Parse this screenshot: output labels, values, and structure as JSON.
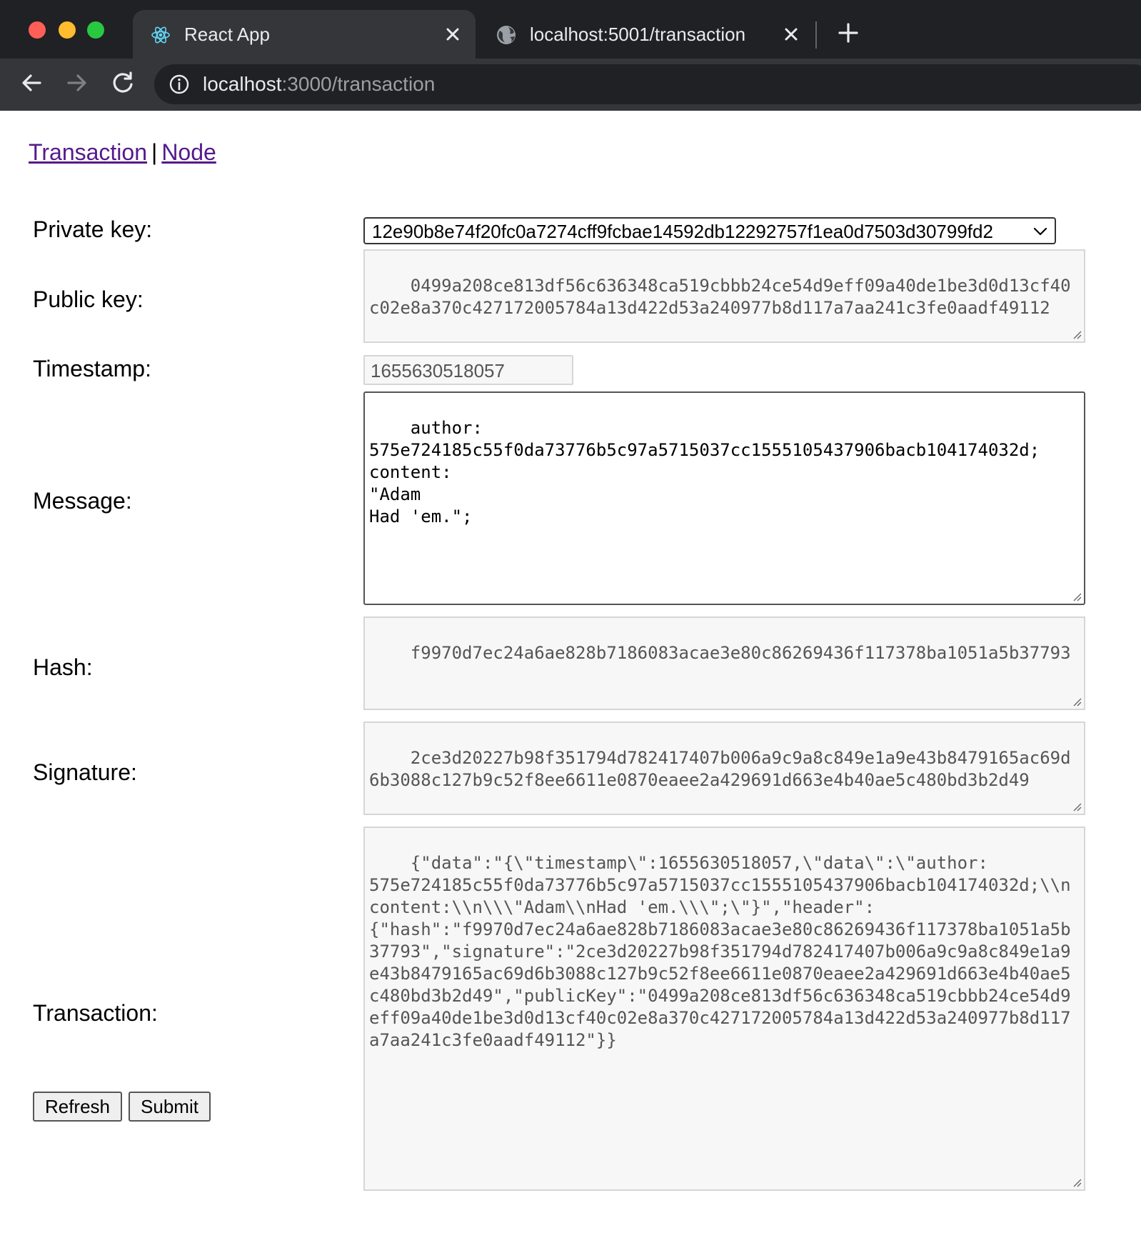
{
  "browser": {
    "tabs": [
      {
        "title": "React App",
        "icon": "react-logo-icon",
        "active": true
      },
      {
        "title": "localhost:5001/transaction",
        "icon": "globe-icon",
        "active": false
      }
    ],
    "address_bar": {
      "host": "localhost",
      "path": ":3000/transaction"
    }
  },
  "nav": {
    "transaction_link": "Transaction",
    "separator": "|",
    "node_link": "Node"
  },
  "form": {
    "private_key": {
      "label": "Private key:",
      "selected": "12e90b8e74f20fc0a7274cff9fcbae14592db12292757f1ea0d7503d30799fd2"
    },
    "public_key": {
      "label": "Public key:",
      "value": "0499a208ce813df56c636348ca519cbbb24ce54d9eff09a40de1be3d0d13cf40c02e8a370c427172005784a13d422d53a240977b8d117a7aa241c3fe0aadf49112"
    },
    "timestamp": {
      "label": "Timestamp:",
      "value": "1655630518057"
    },
    "message": {
      "label": "Message:",
      "value": "author:\n575e724185c55f0da73776b5c97a5715037cc1555105437906bacb104174032d;\ncontent:\n\"Adam\nHad 'em.\";"
    },
    "hash": {
      "label": "Hash:",
      "value": "f9970d7ec24a6ae828b7186083acae3e80c86269436f117378ba1051a5b37793"
    },
    "signature": {
      "label": "Signature:",
      "value": "2ce3d20227b98f351794d782417407b006a9c9a8c849e1a9e43b8479165ac69d6b3088c127b9c52f8ee6611e0870eaee2a429691d663e4b40ae5c480bd3b2d49"
    },
    "transaction": {
      "label": "Transaction:",
      "value": "{\"data\":\"{\\\"timestamp\\\":1655630518057,\\\"data\\\":\\\"author:\n575e724185c55f0da73776b5c97a5715037cc1555105437906bacb104174032d;\\\\ncontent:\\\\n\\\\\\\"Adam\\\\nHad 'em.\\\\\\\";\\\"}\",\"header\":\n{\"hash\":\"f9970d7ec24a6ae828b7186083acae3e80c86269436f117378ba1051a5b37793\",\"signature\":\"2ce3d20227b98f351794d782417407b006a9c9a8c849e1a9e43b8479165ac69d6b3088c127b9c52f8ee6611e0870eaee2a429691d663e4b40ae5c480bd3b2d49\",\"publicKey\":\"0499a208ce813df56c636348ca519cbbb24ce54d9eff09a40de1be3d0d13cf40c02e8a370c427172005784a13d422d53a240977b8d117a7aa241c3fe0aadf49112\"}}"
    }
  },
  "buttons": {
    "refresh": "Refresh",
    "submit": "Submit"
  }
}
